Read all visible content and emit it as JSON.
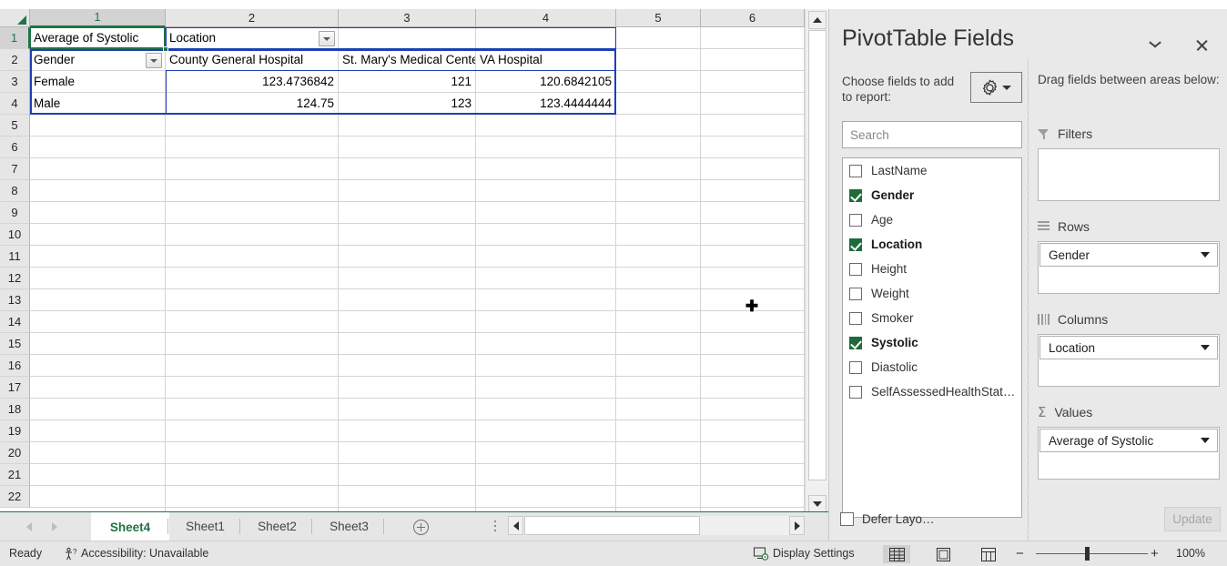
{
  "spreadsheet": {
    "column_headers": [
      "1",
      "2",
      "3",
      "4",
      "5",
      "6"
    ],
    "row_headers": [
      "1",
      "2",
      "3",
      "4",
      "5",
      "6",
      "7",
      "8",
      "9",
      "10",
      "11",
      "12",
      "13",
      "14",
      "15",
      "16",
      "17",
      "18",
      "19",
      "20",
      "21",
      "22"
    ],
    "selected_cell": "A1",
    "cells": {
      "r1c1": "Average of Systolic",
      "r1c2": "Location",
      "r2c1": "Gender",
      "r2c2": "County General Hospital",
      "r2c3": "St. Mary's Medical Center",
      "r2c4": "VA Hospital",
      "r3c1": "Female",
      "r3c2": "123.4736842",
      "r3c3": "121",
      "r3c4": "120.6842105",
      "r4c1": "Male",
      "r4c2": "124.75",
      "r4c3": "123",
      "r4c4": "123.4444444"
    },
    "filter_buttons": [
      "location-filter-icon",
      "gender-filter-icon"
    ]
  },
  "chart_data": {
    "type": "table",
    "title": "Average of Systolic",
    "row_field": "Gender",
    "column_field": "Location",
    "value_field": "Average of Systolic",
    "categories": [
      "County General Hospital",
      "St. Mary's Medical Center",
      "VA Hospital"
    ],
    "series": [
      {
        "name": "Female",
        "values": [
          123.4736842,
          121,
          120.6842105
        ]
      },
      {
        "name": "Male",
        "values": [
          124.75,
          123,
          123.4444444
        ]
      }
    ]
  },
  "sheet_tabs": {
    "tabs": [
      "Sheet4",
      "Sheet1",
      "Sheet2",
      "Sheet3"
    ],
    "active": "Sheet4",
    "add_sheet_label": "add-sheet"
  },
  "status_bar": {
    "ready": "Ready",
    "accessibility": "Accessibility: Unavailable",
    "display_settings": "Display Settings",
    "zoom_level": "100%",
    "views": [
      "normal-view",
      "page-layout-view",
      "page-break-preview"
    ],
    "active_view": "normal-view"
  },
  "pivot_panel": {
    "title": "PivotTable Fields",
    "choose_fields_label": "Choose fields to add to report:",
    "drag_fields_label": "Drag fields between areas below:",
    "search_placeholder": "Search",
    "search_value": "",
    "fields": [
      {
        "name": "LastName",
        "checked": false
      },
      {
        "name": "Gender",
        "checked": true
      },
      {
        "name": "Age",
        "checked": false
      },
      {
        "name": "Location",
        "checked": true
      },
      {
        "name": "Height",
        "checked": false
      },
      {
        "name": "Weight",
        "checked": false
      },
      {
        "name": "Smoker",
        "checked": false
      },
      {
        "name": "Systolic",
        "checked": true
      },
      {
        "name": "Diastolic",
        "checked": false
      },
      {
        "name": "SelfAssessedHealthStat…",
        "checked": false
      }
    ],
    "areas": {
      "filters": {
        "label": "Filters",
        "items": []
      },
      "rows": {
        "label": "Rows",
        "items": [
          "Gender"
        ]
      },
      "columns": {
        "label": "Columns",
        "items": [
          "Location"
        ]
      },
      "values": {
        "label": "Values",
        "items": [
          "Average of Systolic"
        ]
      }
    },
    "defer_layout_label": "Defer Layo…",
    "defer_layout_checked": false,
    "update_label": "Update",
    "update_enabled": false
  },
  "colors": {
    "excel_green": "#217346",
    "pivot_border": "#1f3fb5",
    "panel_bg": "#e9e9e9"
  }
}
